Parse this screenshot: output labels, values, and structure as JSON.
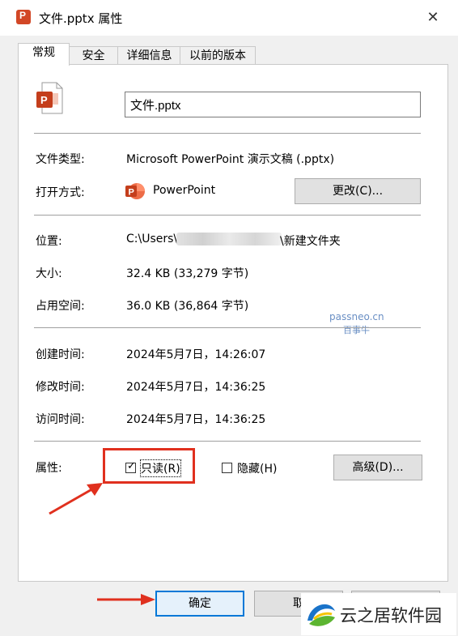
{
  "window": {
    "title": "文件.pptx 属性",
    "close_glyph": "✕"
  },
  "tabs": [
    {
      "label": "常规",
      "active": true
    },
    {
      "label": "安全",
      "active": false
    },
    {
      "label": "详细信息",
      "active": false
    },
    {
      "label": "以前的版本",
      "active": false
    }
  ],
  "general": {
    "file_name": "文件.pptx",
    "type_label": "文件类型:",
    "type_value": "Microsoft PowerPoint 演示文稿 (.pptx)",
    "opens_with_label": "打开方式:",
    "opens_with_value": "PowerPoint",
    "change_button": "更改(C)...",
    "location_label": "位置:",
    "location_prefix": "C:\\Users\\",
    "location_suffix": "\\新建文件夹",
    "size_label": "大小:",
    "size_value": "32.4 KB (33,279 字节)",
    "size_on_disk_label": "占用空间:",
    "size_on_disk_value": "36.0 KB (36,864 字节)",
    "created_label": "创建时间:",
    "created_value": "2024年5月7日，14:26:07",
    "modified_label": "修改时间:",
    "modified_value": "2024年5月7日，14:36:25",
    "accessed_label": "访问时间:",
    "accessed_value": "2024年5月7日，14:36:25",
    "attributes_label": "属性:",
    "readonly_label": "只读(R)",
    "readonly_checked": true,
    "hidden_label": "隐藏(H)",
    "hidden_checked": false,
    "advanced_button": "高级(D)..."
  },
  "watermark": {
    "line1": "passneo.cn",
    "line2": "百事牛"
  },
  "footer": {
    "ok_button": "确定",
    "cancel_button": "取",
    "apply_button": ""
  },
  "overlay_logo": {
    "text": "云之居软件园"
  },
  "colors": {
    "annotation_red": "#e0301e",
    "powerpoint_orange": "#d24726",
    "focus_blue": "#0078d7"
  }
}
